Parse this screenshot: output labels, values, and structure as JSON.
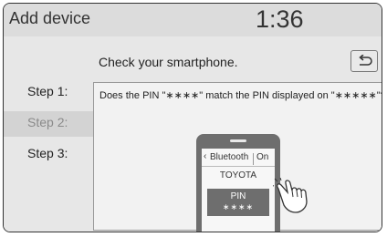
{
  "header": {
    "title": "Add device",
    "clock": "1:36"
  },
  "prompt": "Check your smartphone.",
  "back_button": {
    "icon": "back-arrow-icon"
  },
  "steps": [
    {
      "label": "Step 1:",
      "active": true
    },
    {
      "label": "Step 2:",
      "active": false
    },
    {
      "label": "Step 3:",
      "active": true
    }
  ],
  "question": "Does the PIN \"∗∗∗∗\" match the PIN displayed on \"∗∗∗∗∗\"?",
  "phone": {
    "bluetooth_label": "Bluetooth",
    "bluetooth_state": "On",
    "device_name": "TOYOTA",
    "pin_label": "PIN",
    "pin_code": "∗∗∗∗"
  },
  "colors": {
    "background": "#dcdcdc",
    "phone": "#6e6e6e",
    "content": "#f2f2f2"
  }
}
